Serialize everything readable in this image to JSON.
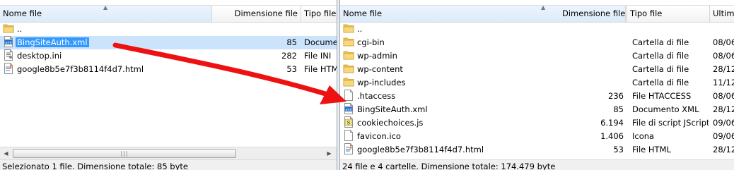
{
  "left": {
    "columns": {
      "name": "Nome file",
      "size": "Dimensione file",
      "type": "Tipo file"
    },
    "files": [
      {
        "name": "..",
        "size": "",
        "type": "",
        "icon": "folder-icon",
        "selected": false
      },
      {
        "name": "BingSiteAuth.xml",
        "size": "85",
        "type": "Documento XML",
        "icon": "xml-file-icon",
        "selected": true
      },
      {
        "name": "desktop.ini",
        "size": "282",
        "type": "File INI",
        "icon": "ini-file-icon",
        "selected": false
      },
      {
        "name": "google8b5e7f3b8114f4d7.html",
        "size": "53",
        "type": "File HTML",
        "icon": "html-file-icon",
        "selected": false
      }
    ],
    "status": "Selezionato 1 file. Dimensione totale: 85 byte"
  },
  "right": {
    "columns": {
      "name": "Nome file",
      "size": "Dimensione file",
      "type": "Tipo file",
      "modified": "Ultima modifica"
    },
    "files": [
      {
        "name": "..",
        "size": "",
        "type": "",
        "modified": "",
        "icon": "folder-icon"
      },
      {
        "name": "cgi-bin",
        "size": "",
        "type": "Cartella di file",
        "modified": "08/06/",
        "icon": "folder-icon"
      },
      {
        "name": "wp-admin",
        "size": "",
        "type": "Cartella di file",
        "modified": "08/06/",
        "icon": "folder-icon"
      },
      {
        "name": "wp-content",
        "size": "",
        "type": "Cartella di file",
        "modified": "28/12/",
        "icon": "folder-icon"
      },
      {
        "name": "wp-includes",
        "size": "",
        "type": "Cartella di file",
        "modified": "11/12/",
        "icon": "folder-icon"
      },
      {
        "name": ".htaccess",
        "size": "236",
        "type": "File HTACCESS",
        "modified": "08/06/",
        "icon": "blank-file-icon"
      },
      {
        "name": "BingSiteAuth.xml",
        "size": "85",
        "type": "Documento XML",
        "modified": "28/12/",
        "icon": "xml-file-icon"
      },
      {
        "name": "cookiechoices.js",
        "size": "6.194",
        "type": "File di script JScript",
        "modified": "09/06/",
        "icon": "js-file-icon"
      },
      {
        "name": "favicon.ico",
        "size": "1.406",
        "type": "Icona",
        "modified": "09/06/",
        "icon": "blank-file-icon"
      },
      {
        "name": "google8b5e7f3b8114f4d7.html",
        "size": "53",
        "type": "File HTML",
        "modified": "28/12/",
        "icon": "html-file-icon"
      }
    ],
    "status": "24 file e 4 cartelle. Dimensione totale: 174.479 byte"
  },
  "colors": {
    "arrow": "#ee1111",
    "selection": "#3399ff",
    "folder": "#f1c453"
  }
}
